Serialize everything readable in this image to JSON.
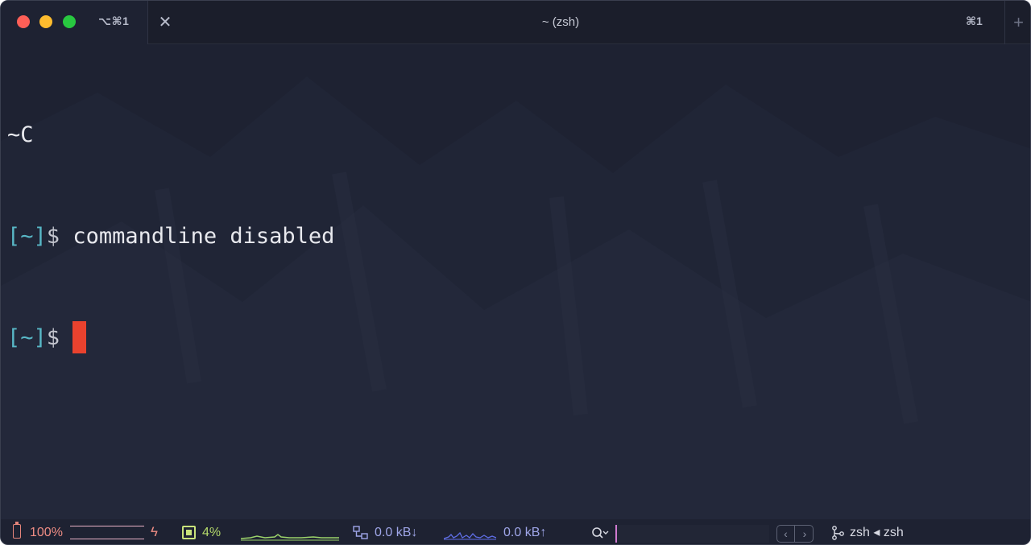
{
  "window": {
    "title": "~ (zsh)",
    "active_tab_shortcut": "⌥⌘1",
    "right_shortcut": "⌘1",
    "close_glyph": "✕",
    "new_tab_glyph": "+"
  },
  "terminal": {
    "lines": [
      {
        "text": "~C"
      },
      {
        "prompt_open": "[",
        "prompt_path": "~",
        "prompt_close": "]",
        "prompt_symbol": "$",
        "command": " commandline disabled"
      },
      {
        "prompt_open": "[",
        "prompt_path": "~",
        "prompt_close": "]",
        "prompt_symbol": "$",
        "command": " "
      }
    ],
    "cursor_color": "#e9422e",
    "prompt_color": "#58b7c6"
  },
  "statusbar": {
    "battery": {
      "icon": "battery-icon",
      "text": "100%",
      "level": 1.0
    },
    "charging_glyph": "ϟ",
    "cpu": {
      "icon": "cpu-icon",
      "text": "4%"
    },
    "network": {
      "icon": "network-icon",
      "download_text": "0.0 kB↓",
      "upload_text": "0.0 kB↑"
    },
    "search": {
      "icon": "search-icon",
      "value": ""
    },
    "nav": {
      "prev_glyph": "‹",
      "next_glyph": "›"
    },
    "job": {
      "icon": "branch-icon",
      "text": "zsh ◂ zsh"
    }
  }
}
